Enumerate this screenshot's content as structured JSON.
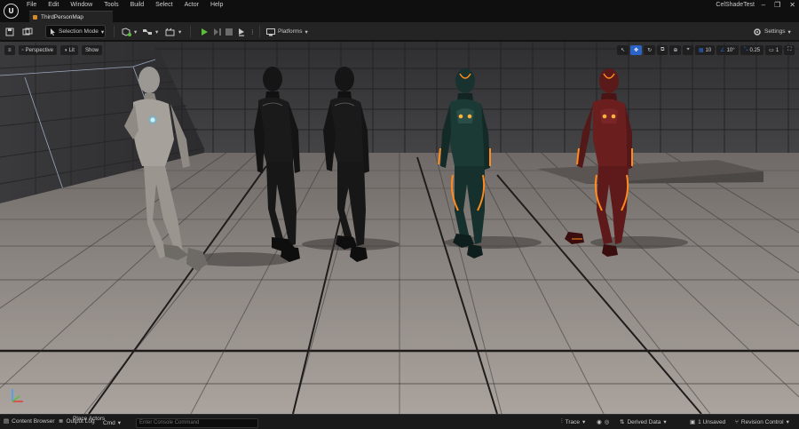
{
  "menu": [
    "File",
    "Edit",
    "Window",
    "Tools",
    "Build",
    "Select",
    "Actor",
    "Help"
  ],
  "tab_title": "ThirdPersonMap",
  "project_name": "CelShadeTest",
  "window_controls": [
    "–",
    "❐",
    "✕"
  ],
  "toolbar": {
    "selection_mode": "Selection Mode",
    "platforms": "Platforms",
    "settings": "Settings"
  },
  "viewport": {
    "perspective": "Perspective",
    "lit": "Lit",
    "show": "Show",
    "grid_snap": "10",
    "rotation_snap": "10°",
    "scale_snap": "0.25",
    "camera_speed": "1"
  },
  "status": {
    "content_browser": "Content Browser",
    "output_log": "Output Log",
    "cmd": "Cmd",
    "cmd_placeholder": "Enter Console Command",
    "place_actors": "Place Actors",
    "trace": "Trace",
    "derived_data": "Derived Data",
    "unsaved": "1 Unsaved",
    "revision_control": "Revision Control"
  },
  "colors": {
    "accent_blue": "#2b63c7",
    "play_green": "#5bbf3a",
    "tab_orange": "#d58a2a",
    "glow_orange": "#ff8a1e"
  }
}
